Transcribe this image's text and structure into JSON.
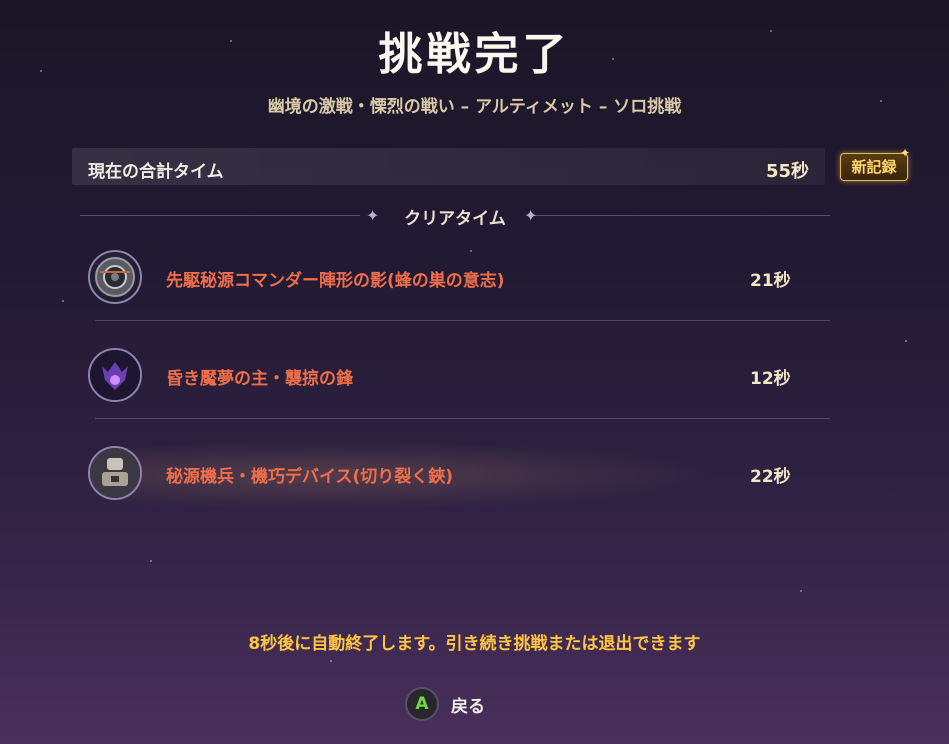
{
  "title": "挑戦完了",
  "subtitle": "幽境の激戦・慄烈の戦い – アルティメット – ソロ挑戦",
  "total": {
    "label": "現在の合計タイム",
    "time": "55秒",
    "badge": "新記録"
  },
  "section_label": "クリアタイム",
  "bosses": [
    {
      "name": "先駆秘源コマンダー陣形の影(蜂の巣の意志)",
      "time": "21秒",
      "icon": "commander-boss-icon"
    },
    {
      "name": "昏き魘夢の主・襲掠の鋒",
      "time": "12秒",
      "icon": "nightmare-boss-icon"
    },
    {
      "name": "秘源機兵・機巧デバイス(切り裂く鋏)",
      "time": "22秒",
      "icon": "construct-boss-icon"
    }
  ],
  "footer_message": "8秒後に自動終了します。引き続き挑戦または退出できます",
  "back": {
    "key": "A",
    "label": "戻る"
  },
  "colors": {
    "accent_gold": "#ffc542",
    "boss_name": "#ee6e4a",
    "key_green": "#6fdc3c"
  }
}
